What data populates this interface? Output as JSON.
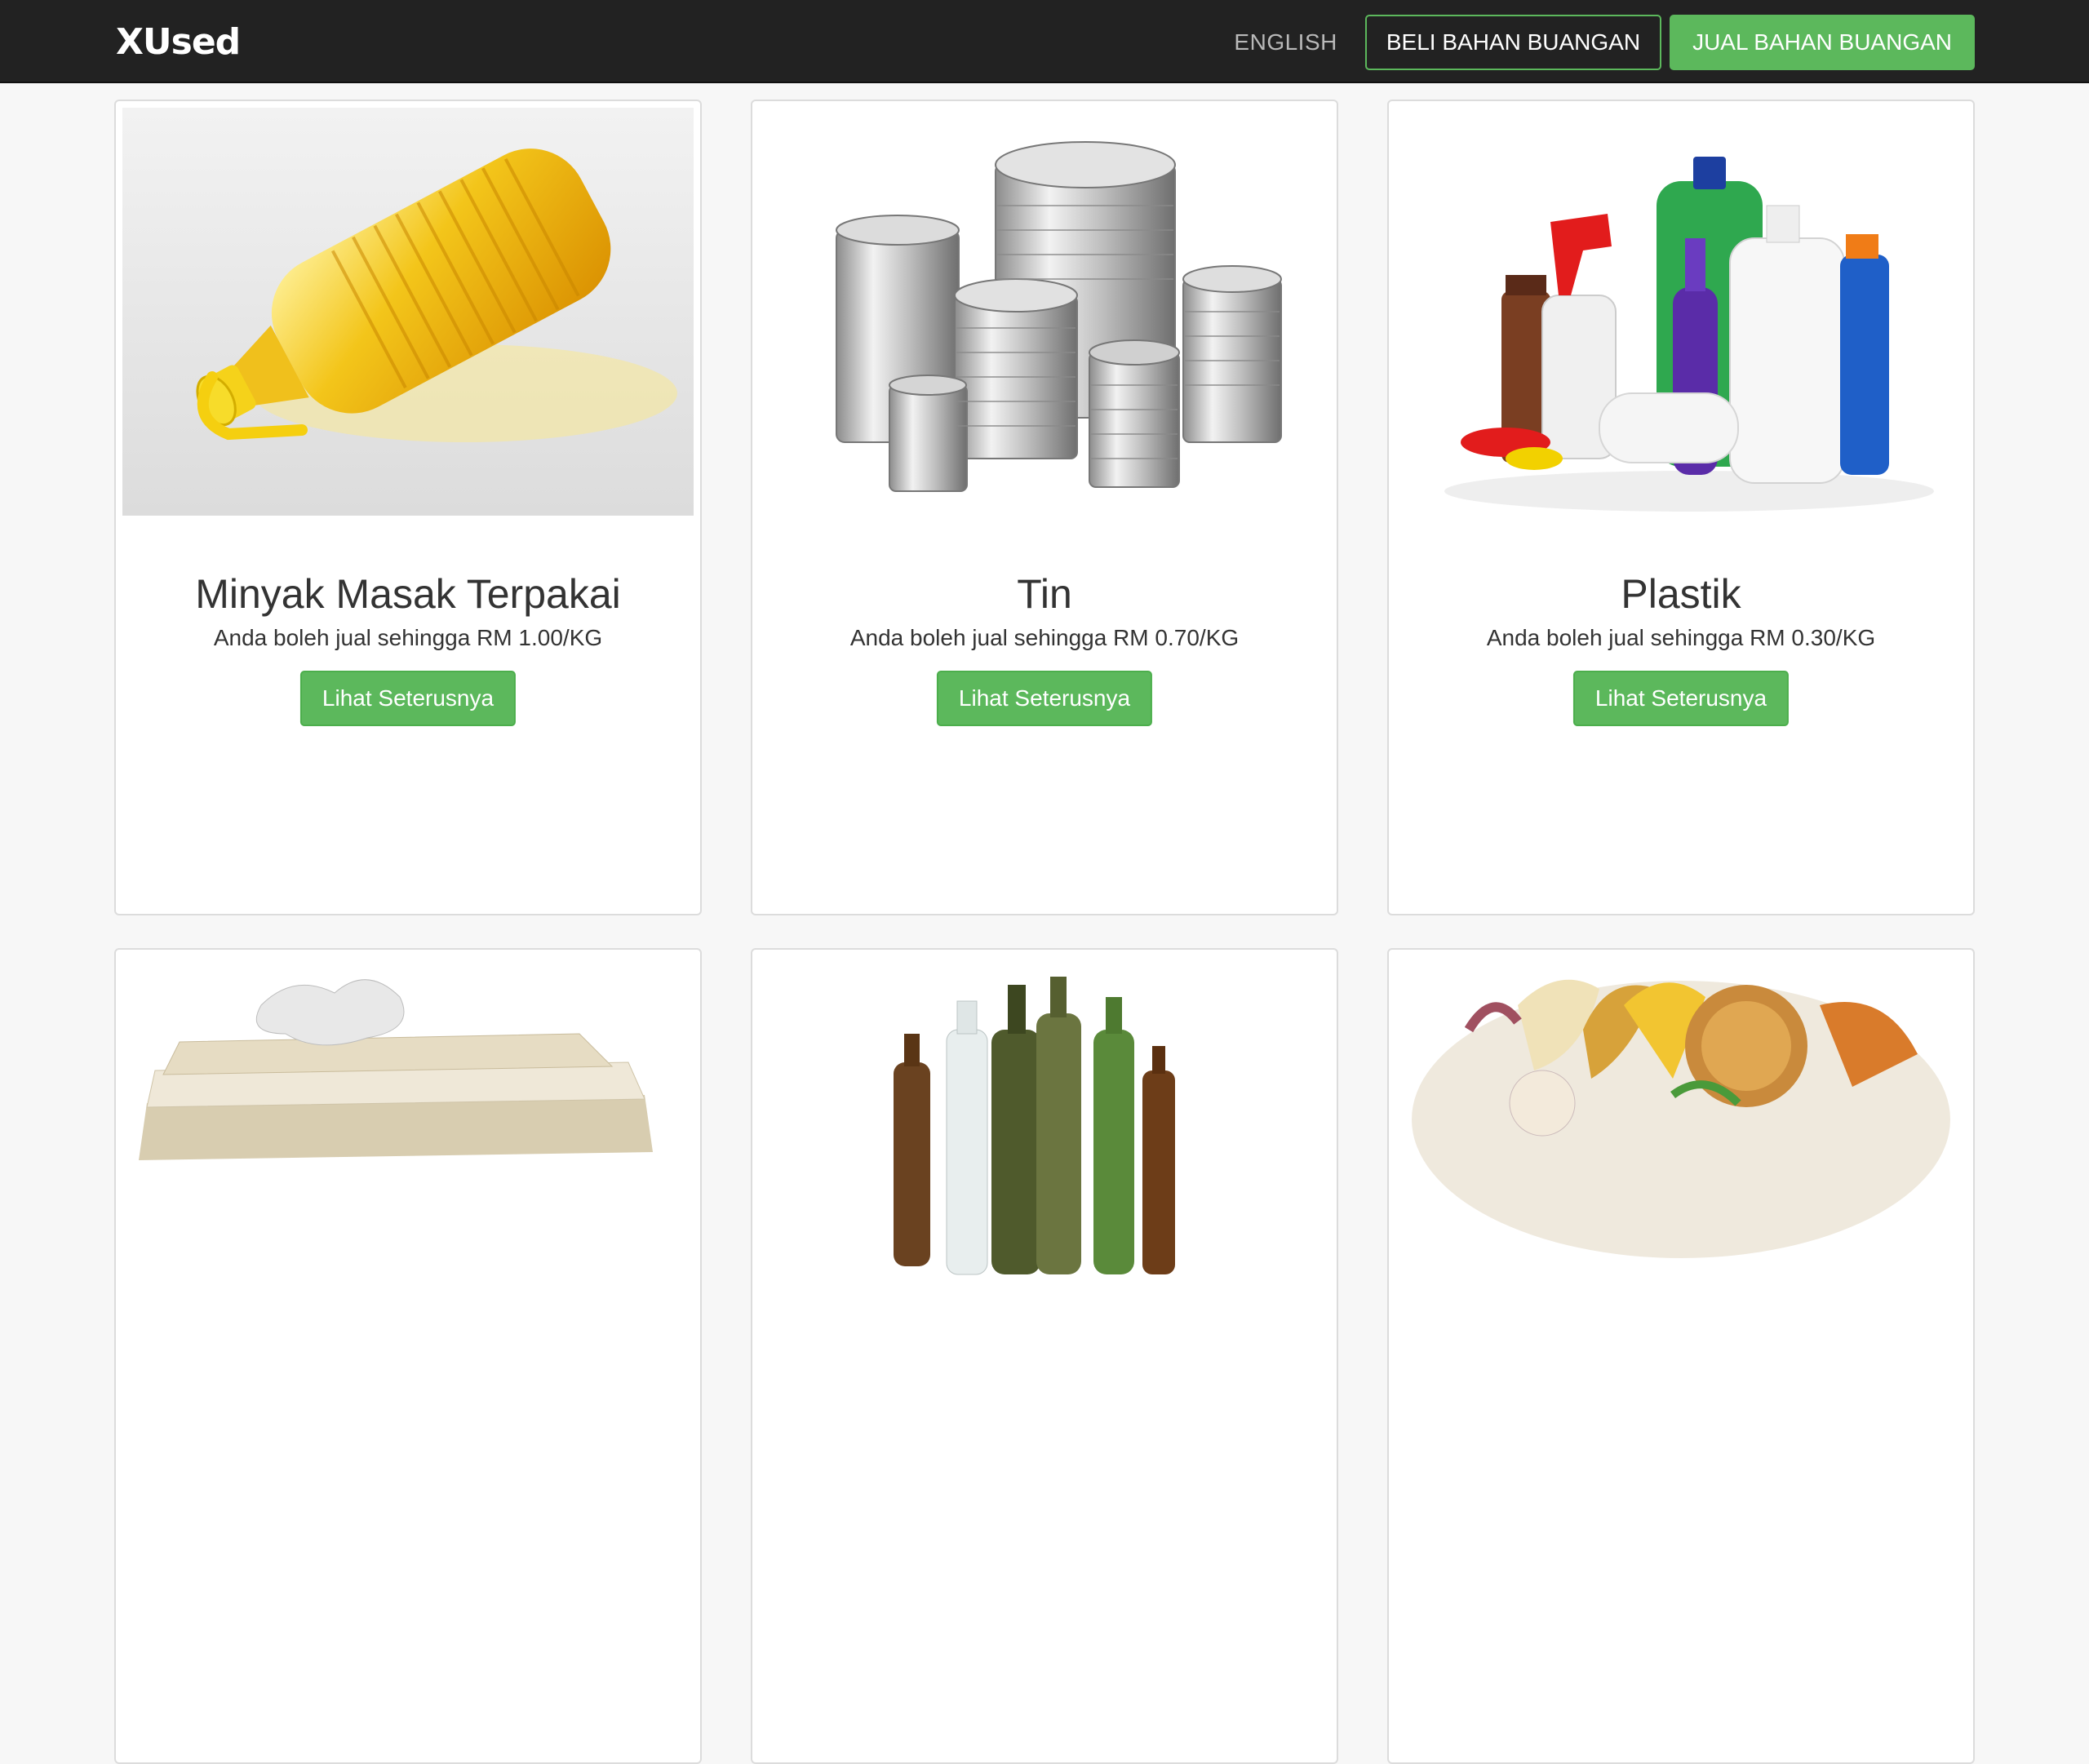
{
  "navbar": {
    "brand": "XUsed",
    "language": "ENGLISH",
    "buy_label": "BELI BAHAN BUANGAN",
    "sell_label": "JUAL BAHAN BUANGAN"
  },
  "products": [
    {
      "title": "Minyak Masak Terpakai",
      "price": "Anda boleh jual sehingga RM 1.00/KG",
      "button": "Lihat Seterusnya",
      "image": "cooking-oil-bottle-image"
    },
    {
      "title": "Tin",
      "price": "Anda boleh jual sehingga RM 0.70/KG",
      "button": "Lihat Seterusnya",
      "image": "tin-cans-image"
    },
    {
      "title": "Plastik",
      "price": "Anda boleh jual sehingga RM 0.30/KG",
      "button": "Lihat Seterusnya",
      "image": "plastic-bottles-image"
    },
    {
      "image": "paper-image"
    },
    {
      "image": "glass-bottles-image"
    },
    {
      "image": "food-waste-image"
    }
  ],
  "colors": {
    "navbar_bg": "#222222",
    "accent_green": "#5cb85c",
    "page_bg": "#f7f7f7"
  }
}
